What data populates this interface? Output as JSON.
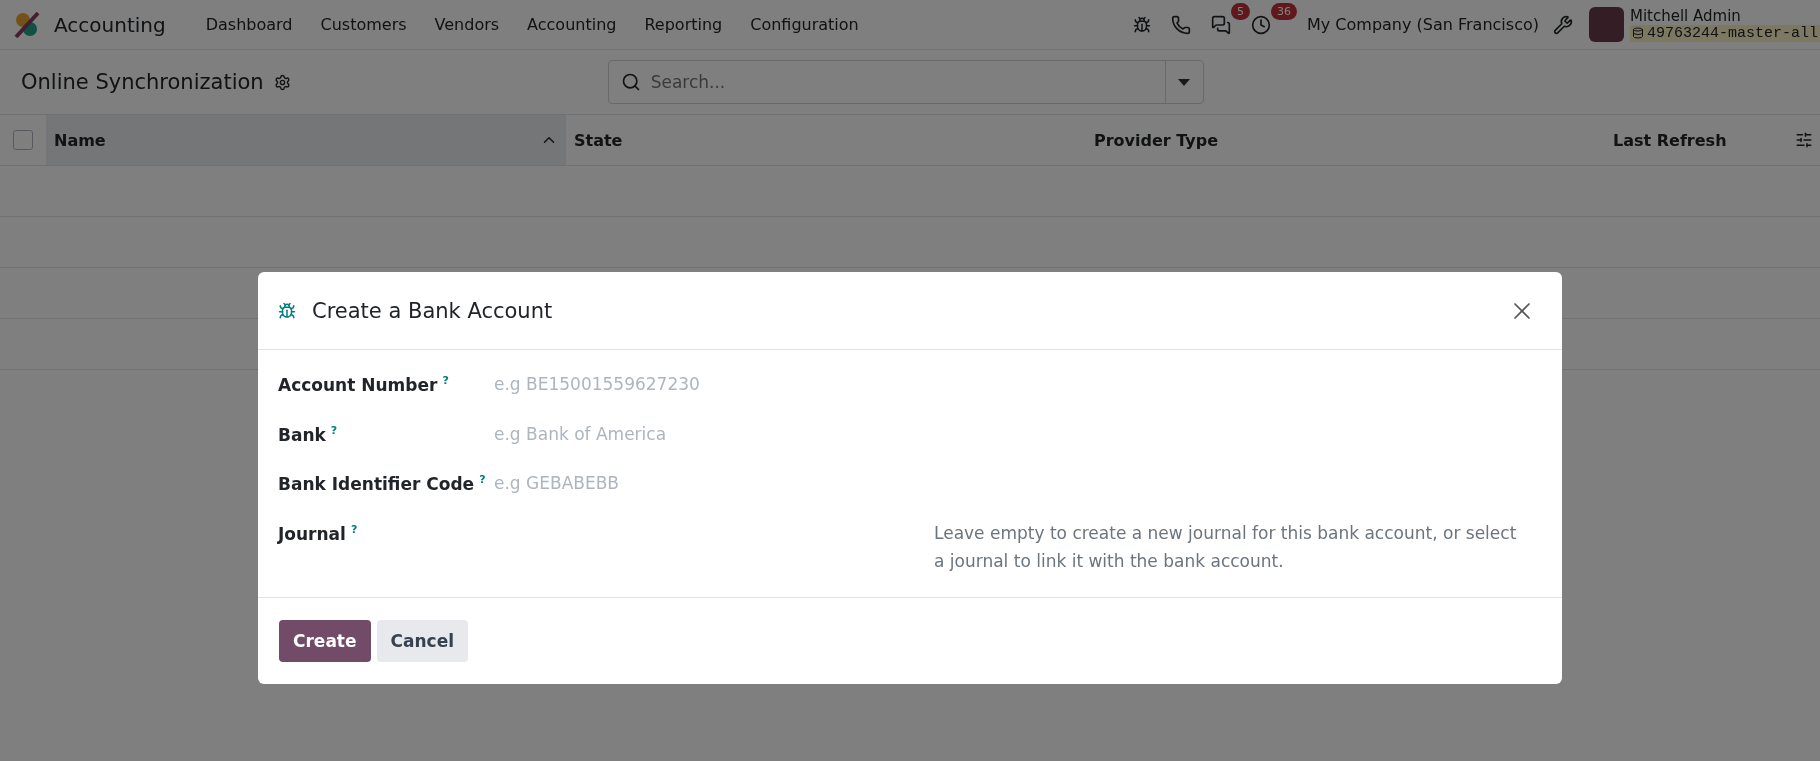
{
  "navbar": {
    "app_name": "Accounting",
    "menu": [
      "Dashboard",
      "Customers",
      "Vendors",
      "Accounting",
      "Reporting",
      "Configuration"
    ],
    "systray": [
      {
        "kind": "debug"
      },
      {
        "kind": "phone"
      },
      {
        "kind": "messages",
        "badge": "5"
      },
      {
        "kind": "activity",
        "badge": "36"
      }
    ],
    "company": "My Company (San Francisco)",
    "user": {
      "name": "Mitchell Admin",
      "database": "49763244-master-all"
    }
  },
  "control_panel": {
    "title": "Online Synchronization",
    "search": {
      "placeholder": "Search..."
    }
  },
  "table": {
    "select_all_checked": false,
    "columns": [
      {
        "label": "Name",
        "sorted": true
      },
      {
        "label": "State",
        "sorted": false
      },
      {
        "label": "Provider Type",
        "sorted": false
      },
      {
        "label": "Last Refresh",
        "sorted": false
      }
    ]
  },
  "dialog": {
    "title": "Create a Bank Account",
    "fields": [
      {
        "label": "Account Number",
        "help": "?",
        "placeholder": "e.g BE15001559627230"
      },
      {
        "label": "Bank",
        "help": "?",
        "placeholder": "e.g Bank of America"
      },
      {
        "label": "Bank Identifier Code",
        "help": "?",
        "placeholder": "e.g GEBABEBB"
      },
      {
        "label": "Journal",
        "help": "?",
        "note": "Leave empty to create a new journal for this bank account, or select a journal to link it with the bank account."
      }
    ],
    "buttons": [
      {
        "label": "Create",
        "kind": "primary"
      },
      {
        "label": "Cancel",
        "kind": "secondary"
      }
    ]
  }
}
